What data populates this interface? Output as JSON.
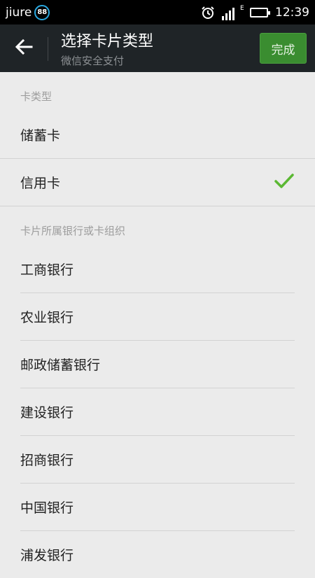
{
  "status_bar": {
    "carrier": "jiure",
    "badge_count": "88",
    "network_type": "E",
    "time": "12:39",
    "icons": [
      "alarm-icon",
      "signal-icon",
      "battery-icon"
    ]
  },
  "app_bar": {
    "title": "选择卡片类型",
    "subtitle": "微信安全支付",
    "done_label": "完成",
    "back_icon": "back-arrow-icon"
  },
  "card_type_section": {
    "header": "卡类型",
    "items": [
      {
        "label": "储蓄卡",
        "selected": false
      },
      {
        "label": "信用卡",
        "selected": true
      }
    ]
  },
  "bank_section": {
    "header": "卡片所属银行或卡组织",
    "items": [
      {
        "label": "工商银行"
      },
      {
        "label": "农业银行"
      },
      {
        "label": "邮政储蓄银行"
      },
      {
        "label": "建设银行"
      },
      {
        "label": "招商银行"
      },
      {
        "label": "中国银行"
      },
      {
        "label": "浦发银行"
      }
    ]
  },
  "colors": {
    "accent_green": "#3a8d30",
    "check_green": "#5bb833",
    "app_bar_bg": "#1f2427",
    "page_bg": "#ebebeb"
  }
}
